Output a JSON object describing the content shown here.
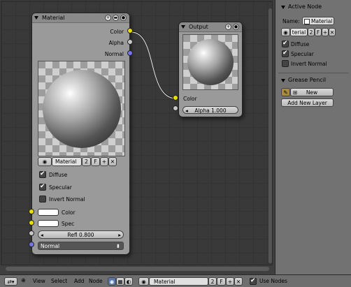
{
  "nodes": {
    "material": {
      "title": "Material",
      "outputs": [
        "Color",
        "Alpha",
        "Normal"
      ],
      "datablock": "Material",
      "users": "2",
      "fake_user": "F",
      "diffuse_label": "Diffuse",
      "specular_label": "Specular",
      "invert_normal_label": "Invert Normal",
      "inputs": {
        "color_label": "Color",
        "spec_label": "Spec",
        "refl_label": "Refl 0.800",
        "normal_label": "Normal"
      }
    },
    "output": {
      "title": "Output",
      "color_label": "Color",
      "alpha_label": "Alpha 1.000"
    }
  },
  "sidebar": {
    "active_node": {
      "title": "Active Node",
      "name_label": "Name:",
      "name_value": "Material",
      "datablock": "terial",
      "users": "2",
      "fake_user": "F",
      "diffuse_label": "Diffuse",
      "specular_label": "Specular",
      "invert_normal_label": "Invert Normal"
    },
    "grease_pencil": {
      "title": "Grease Pencil",
      "new_label": "New",
      "add_layer_label": "Add New Layer"
    }
  },
  "footer": {
    "view": "View",
    "select": "Select",
    "add": "Add",
    "node": "Node",
    "material": "Material",
    "users": "2",
    "fake_user": "F",
    "use_nodes": "Use Nodes"
  }
}
